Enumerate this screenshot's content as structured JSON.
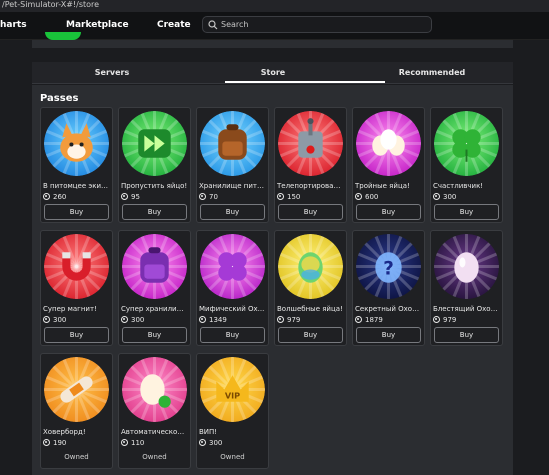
{
  "browser": {
    "url": "/Pet-Simulator-X#!/store"
  },
  "nav": {
    "charts": "harts",
    "marketplace": "Marketplace",
    "create": "Create",
    "search_placeholder": "Search"
  },
  "tabs": [
    {
      "label": "Servers",
      "active": false
    },
    {
      "label": "Store",
      "active": true
    },
    {
      "label": "Recommended",
      "active": false
    }
  ],
  "section_title": "Passes",
  "passes": [
    {
      "name": "В питомцее экип...",
      "price": "260",
      "action": "Buy",
      "icon": "corgi-pet-icon",
      "ring": [
        "#6ad0ff",
        "#1f86e0"
      ]
    },
    {
      "name": "Пропустить яйцо!",
      "price": "95",
      "action": "Buy",
      "icon": "skip-forward-icon",
      "ring": [
        "#7ef07a",
        "#1fae3c"
      ]
    },
    {
      "name": "Хранилище пито...",
      "price": "70",
      "action": "Buy",
      "icon": "backpack-icon",
      "ring": [
        "#7ad6ff",
        "#2696e6"
      ]
    },
    {
      "name": "Телепортироват...",
      "price": "150",
      "action": "Buy",
      "icon": "teleport-switch-icon",
      "ring": [
        "#ff7c7c",
        "#d91e2a"
      ]
    },
    {
      "name": "Тройные яйца!",
      "price": "600",
      "action": "Buy",
      "icon": "triple-eggs-icon",
      "ring": [
        "#ff8ff0",
        "#c21ec6"
      ]
    },
    {
      "name": "Счастливчик!",
      "price": "300",
      "action": "Buy",
      "icon": "clover-icon",
      "ring": [
        "#7ef07a",
        "#1fae3c"
      ]
    },
    {
      "name": "Супер магнит!",
      "price": "300",
      "action": "Buy",
      "icon": "magnet-icon",
      "ring": [
        "#ff7c7c",
        "#d91e2a"
      ]
    },
    {
      "name": "Супер хранилищ...",
      "price": "300",
      "action": "Buy",
      "icon": "purple-backpack-icon",
      "ring": [
        "#ff8ff0",
        "#c21ec6"
      ]
    },
    {
      "name": "Мифический Ох...",
      "price": "1349",
      "action": "Buy",
      "icon": "mythical-clover-icon",
      "ring": [
        "#ff8ff0",
        "#b31ec6"
      ]
    },
    {
      "name": "Волшебные яйца!",
      "price": "979",
      "action": "Buy",
      "icon": "rainbow-egg-icon",
      "ring": [
        "#fff27a",
        "#e0c21f"
      ]
    },
    {
      "name": "Секретный Охот...",
      "price": "1879",
      "action": "Buy",
      "icon": "secret-egg-icon",
      "ring": [
        "#2c3a8a",
        "#0c1240"
      ]
    },
    {
      "name": "Блестящий Охот...",
      "price": "979",
      "action": "Buy",
      "icon": "shiny-egg-icon",
      "ring": [
        "#6a3a8a",
        "#24123a"
      ]
    },
    {
      "name": "Ховерборд!",
      "price": "190",
      "action": "Owned",
      "icon": "hoverboard-icon",
      "ring": [
        "#ffc04a",
        "#ef8a1c"
      ]
    },
    {
      "name": "Автоматическое ...",
      "price": "110",
      "action": "Owned",
      "icon": "auto-egg-icon",
      "ring": [
        "#ff8cc9",
        "#e03a8a"
      ]
    },
    {
      "name": "ВИП!",
      "price": "300",
      "action": "Owned",
      "icon": "vip-crown-icon",
      "ring": [
        "#ffd84a",
        "#f0a81c"
      ],
      "icon_text": "VIP"
    }
  ]
}
